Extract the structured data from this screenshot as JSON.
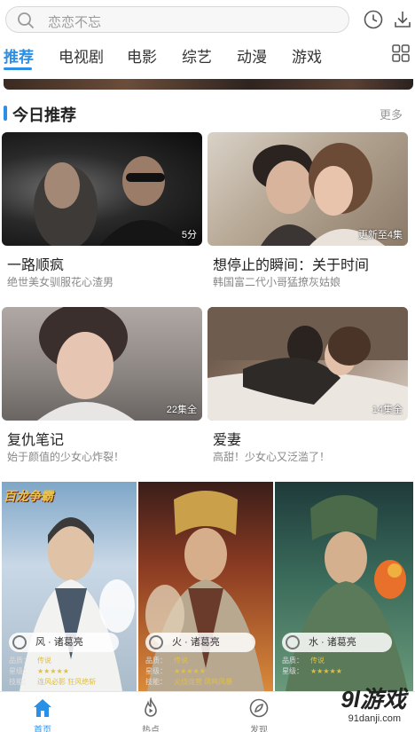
{
  "search": {
    "placeholder": "恋恋不忘"
  },
  "tabs": [
    {
      "label": "推荐",
      "active": true
    },
    {
      "label": "电视剧"
    },
    {
      "label": "电影"
    },
    {
      "label": "综艺"
    },
    {
      "label": "动漫"
    },
    {
      "label": "游戏"
    }
  ],
  "section": {
    "title": "今日推荐",
    "more": "更多"
  },
  "cards": [
    {
      "title": "一路顺疯",
      "subtitle": "绝世美女驯服花心渣男",
      "badge": "5分"
    },
    {
      "title": "想停止的瞬间：关于时间",
      "subtitle": "韩国富二代小哥猛撩灰姑娘",
      "badge": "更新至4集"
    },
    {
      "title": "复仇笔记",
      "subtitle": "始于颜值的少女心炸裂！",
      "badge": "22集全"
    },
    {
      "title": "爱妻",
      "subtitle": "高甜！少女心又泛滥了！",
      "badge": "14集全"
    }
  ],
  "game_banner": {
    "logo": "百龙争霸",
    "heroes": [
      {
        "name": "风 · 诸葛亮",
        "quality_label": "品质：",
        "quality": "传说",
        "stars_label": "星级：",
        "stars": "★★★★★",
        "skill_label": "技能：",
        "skill": "连风必影  狂风绝斩"
      },
      {
        "name": "火 · 诸葛亮",
        "quality_label": "品质：",
        "quality": "传说",
        "stars_label": "星级：",
        "stars": "★★★★★",
        "skill_label": "技能：",
        "skill": "火烧连营  凤鸣风暴"
      },
      {
        "name": "水 · 诸葛亮",
        "quality_label": "品质：",
        "quality": "传说",
        "stars_label": "星级：",
        "stars": "★★★★★",
        "skill_label": "",
        "skill": ""
      }
    ]
  },
  "bottom_nav": [
    {
      "label": "首页",
      "icon": "home-icon",
      "active": true
    },
    {
      "label": "热点",
      "icon": "flame-icon"
    },
    {
      "label": "发现",
      "icon": "compass-icon"
    }
  ],
  "watermark": {
    "brand": "9l游戏",
    "url": "91danji.com"
  },
  "colors": {
    "accent": "#2b8fe6"
  }
}
